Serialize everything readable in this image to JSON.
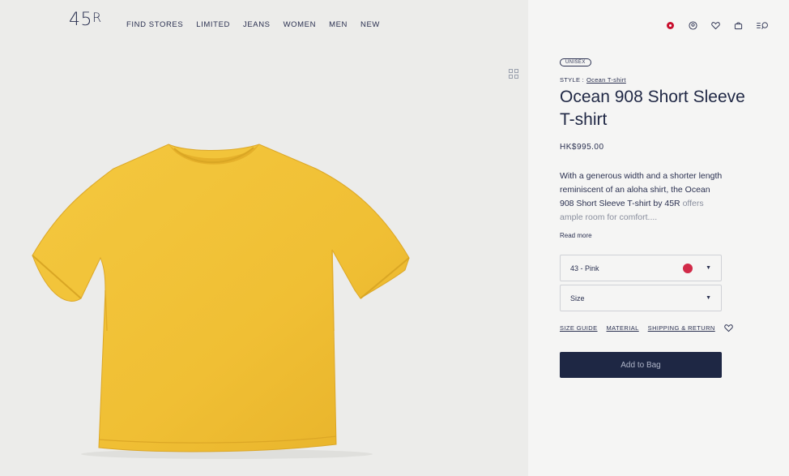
{
  "brand": {
    "logo_text": "45",
    "logo_mark": "R"
  },
  "nav": {
    "items": [
      {
        "label": "FIND STORES"
      },
      {
        "label": "LIMITED"
      },
      {
        "label": "JEANS"
      },
      {
        "label": "WOMEN"
      },
      {
        "label": "MEN"
      },
      {
        "label": "NEW"
      }
    ]
  },
  "header_icons": [
    "region-flag-icon",
    "account-icon",
    "wishlist-icon",
    "bag-icon",
    "menu-search-icon"
  ],
  "product": {
    "badge": "UNISEX",
    "style_label": "STYLE :",
    "style_link": "Ocean T-shirt",
    "title": "Ocean 908 Short Sleeve T-shirt",
    "price": "HK$995.00",
    "description": "With a generous width and a shorter length reminiscent of an aloha shirt, the Ocean 908 Short Sleeve T-shirt by 45R",
    "description_fade": "offers ample room for comfort....",
    "read_more": "Read more",
    "image_color": "#f2c23a"
  },
  "selectors": {
    "color": {
      "value": "43 - Pink",
      "swatch": "#d12a48"
    },
    "size": {
      "value": "Size"
    }
  },
  "links": {
    "size_guide": "SIZE GUIDE",
    "material": "MATERIAL",
    "shipping": "SHIPPING & RETURN"
  },
  "add_to_bag": "Add to Bag",
  "colors": {
    "navy": "#1e2744",
    "left_bg": "#ececea",
    "right_bg": "#f5f5f4"
  }
}
